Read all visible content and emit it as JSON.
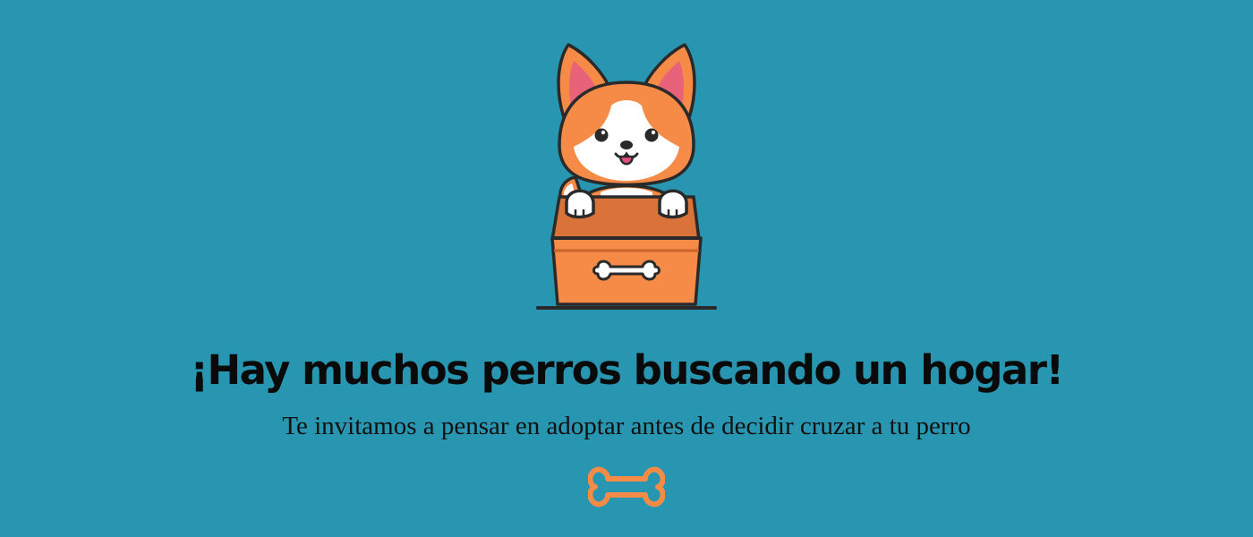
{
  "hero": {
    "illustration_name": "corgi-in-box",
    "headline": "¡Hay muchos perros buscando un hogar!",
    "subheadline": "Te invitamos a pensar en adoptar antes de decidir cruzar a tu perro",
    "footer_icon": "bone-icon"
  },
  "colors": {
    "background": "#2896b0",
    "accent": "#f58b46",
    "text": "#0a0a0a"
  }
}
